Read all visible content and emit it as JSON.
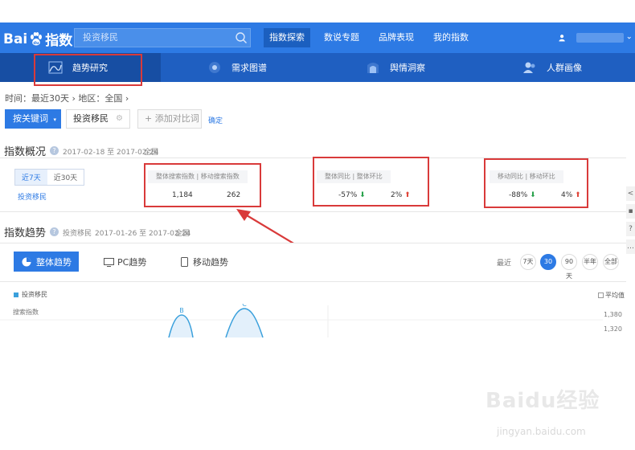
{
  "header": {
    "logo_text_left": "Bai",
    "logo_text_right": "指数",
    "search_placeholder": "投资移民",
    "nav": [
      "指数探索",
      "数说专题",
      "品牌表现",
      "我的指数"
    ]
  },
  "subnav": {
    "tabs": [
      "趋势研究",
      "需求图谱",
      "舆情洞察",
      "人群画像"
    ]
  },
  "filters": {
    "breadcrumb": "时间：最近30天 › 地区：全国 ›",
    "keyword_button": "按关键词",
    "keyword_tag": "投资移民",
    "add_compare": "+ 添加对比词",
    "confirm": "确定"
  },
  "overview": {
    "title": "指数概况",
    "date_range": "2017-02-18 至 2017-02-24",
    "region": "全国",
    "period_tabs": [
      "近7天",
      "近30天"
    ],
    "keyword": "投资移民",
    "metrics": {
      "search_head": "整体搜索指数  |  移动搜索指数",
      "overall_search": "1,184",
      "mobile_search": "262",
      "overall_head": "整体同比  |  整体环比",
      "overall_yoy": "-57%",
      "overall_mom": "2%",
      "mobile_head": "移动同比  |  移动环比",
      "mobile_yoy": "-88%",
      "mobile_mom": "4%"
    }
  },
  "trend": {
    "title": "指数趋势",
    "keyword": "投资移民",
    "date_range": "2017-01-26 至 2017-02-24",
    "region": "全国",
    "tabs": [
      "整体趋势",
      "PC趋势",
      "移动趋势"
    ],
    "range_label": "最近",
    "ranges": [
      "7天",
      "30天",
      "90天",
      "半年",
      "全部"
    ],
    "legend": "投资移民",
    "avg_label": "平均值",
    "y_title": "搜索指数",
    "y_ticks": [
      "1,380",
      "1,320"
    ],
    "peak_labels": [
      "B",
      "C"
    ]
  },
  "watermark": {
    "text": "Baidu经验",
    "url": "jingyan.baidu.com"
  }
}
